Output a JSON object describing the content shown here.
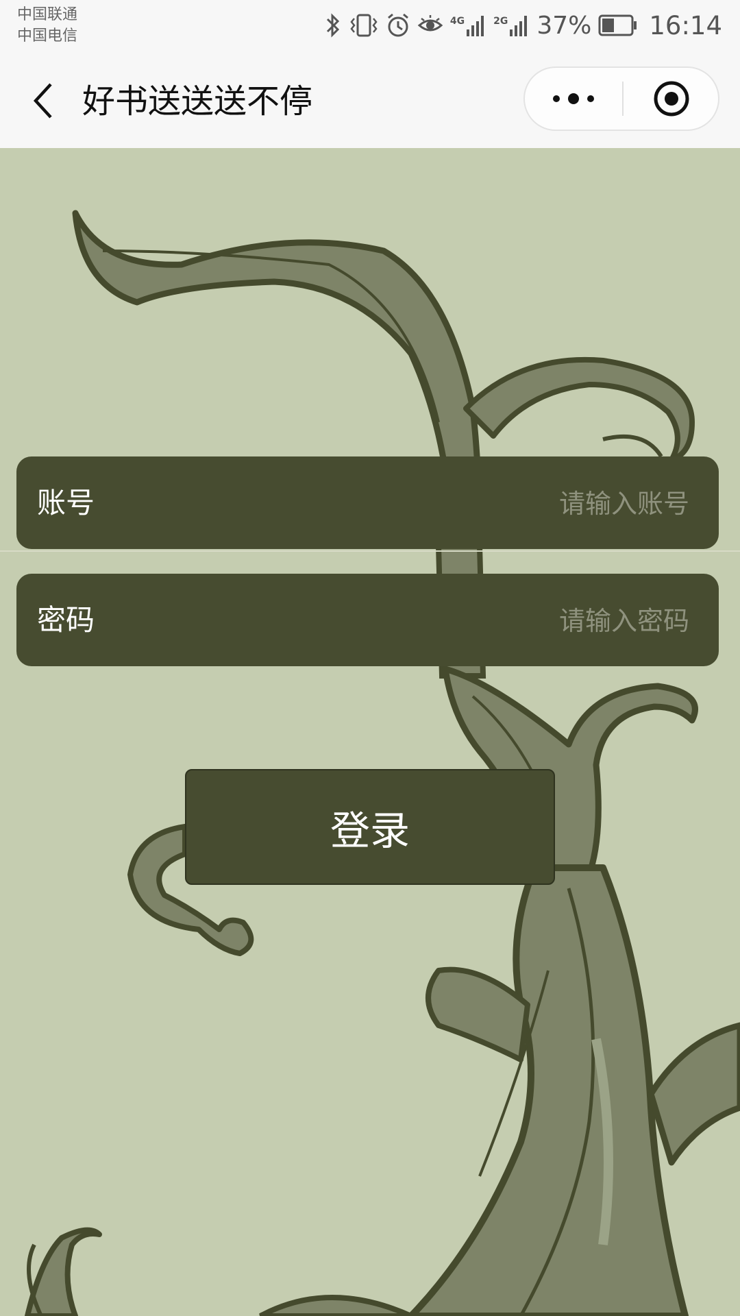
{
  "status_bar": {
    "carrier_1": "中国联通",
    "carrier_2": "中国电信",
    "network_1": "4G",
    "network_2": "2G",
    "battery_percent": "37%",
    "time": "16:14"
  },
  "title_bar": {
    "title": "好书送送送不停",
    "back_icon": "chevron-left-icon",
    "more_icon": "more-dots-icon",
    "close_icon": "target-close-icon"
  },
  "form": {
    "account_label": "账号",
    "account_placeholder": "请输入账号",
    "account_value": "",
    "password_label": "密码",
    "password_placeholder": "请输入密码",
    "password_value": "",
    "login_label": "登录"
  },
  "colors": {
    "background": "#c5cdb0",
    "field_bg": "#474c30",
    "vine_dark": "#454a2d",
    "vine_fill": "#7e8468",
    "header_bg": "#f7f7f7"
  }
}
